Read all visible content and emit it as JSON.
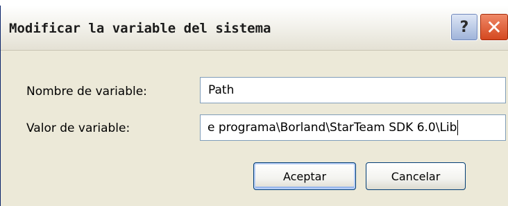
{
  "window": {
    "title": "Modificar la variable del sistema",
    "help_glyph": "?",
    "close_glyph": "✕"
  },
  "form": {
    "name_label": "Nombre de variable:",
    "name_value": "Path",
    "value_label": "Valor de variable:",
    "value_value": "e programa\\Borland\\StarTeam SDK 6.0\\Lib"
  },
  "buttons": {
    "ok_label": "Aceptar",
    "cancel_label": "Cancelar"
  },
  "colors": {
    "dialog_bg": "#ece9d8",
    "close_button": "#d3461e",
    "help_button": "#9eb3d9",
    "input_border": "#7f9db9"
  }
}
